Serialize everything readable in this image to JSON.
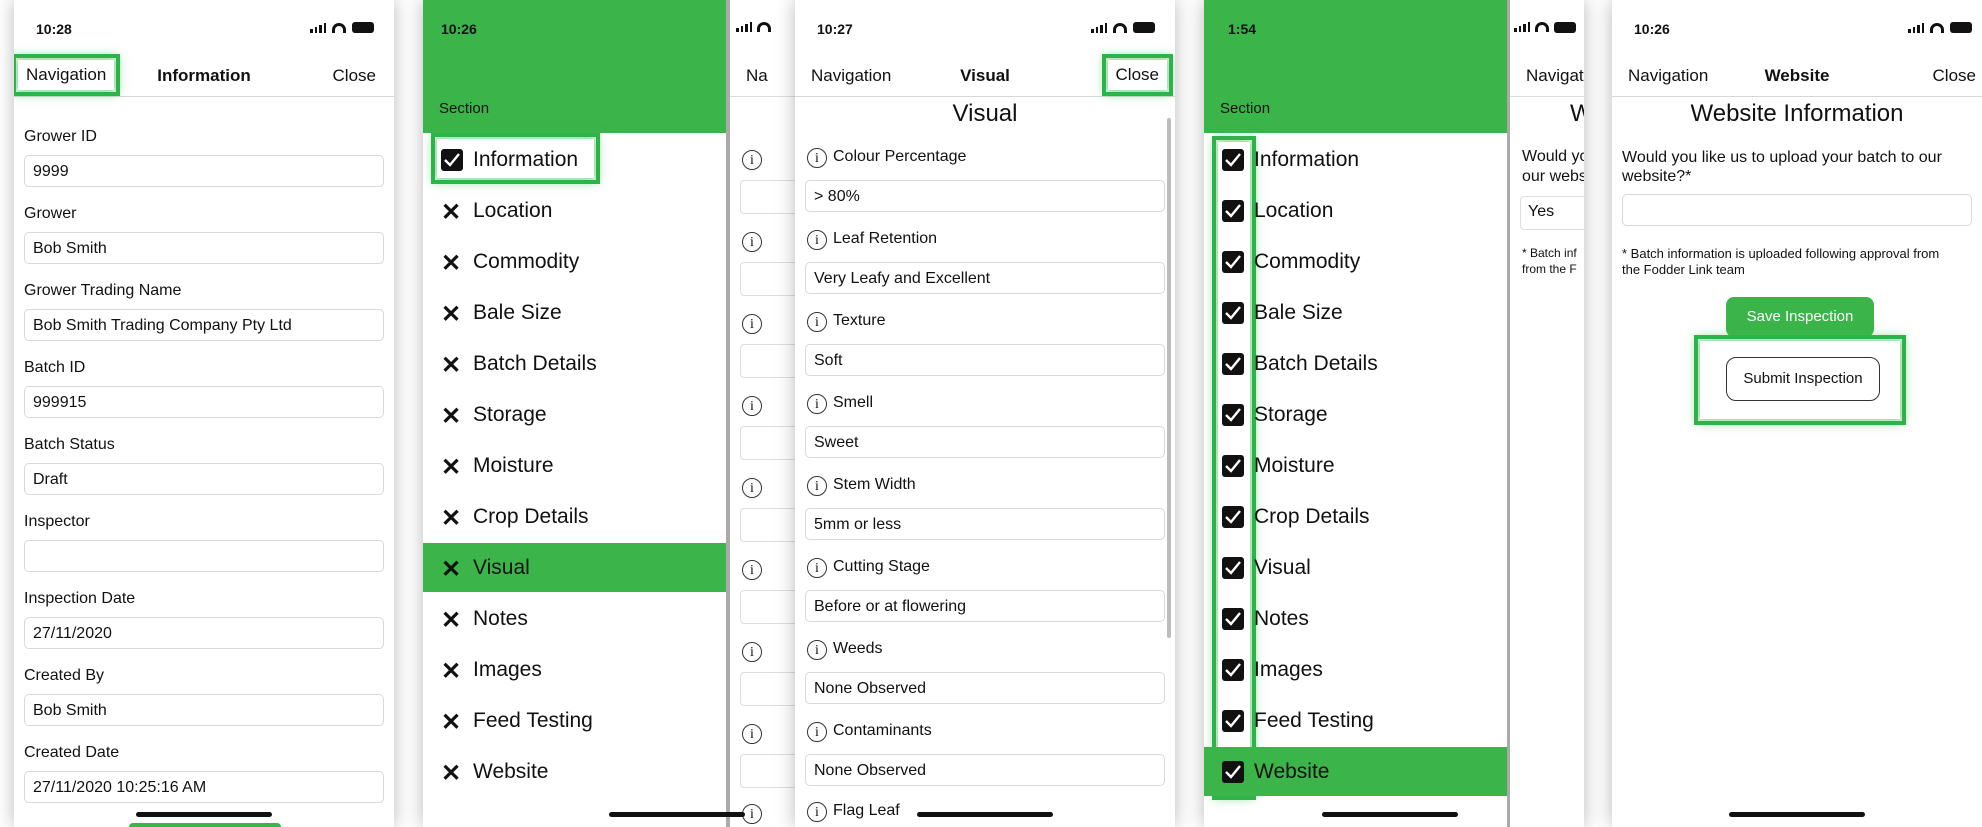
{
  "colors": {
    "accent": "#3bb44a",
    "highlight": "#2db34a"
  },
  "screen1": {
    "time": "10:28",
    "nav": {
      "left": "Navigation",
      "title": "Information",
      "right": "Close"
    },
    "fields": [
      {
        "label": "Grower ID",
        "value": "9999"
      },
      {
        "label": "Grower",
        "value": "Bob Smith"
      },
      {
        "label": "Grower Trading Name",
        "value": "Bob Smith Trading Company Pty Ltd"
      },
      {
        "label": "Batch ID",
        "value": "999915"
      },
      {
        "label": "Batch Status",
        "value": "Draft"
      },
      {
        "label": "Inspector",
        "value": ""
      },
      {
        "label": "Inspection Date",
        "value": "27/11/2020"
      },
      {
        "label": "Created By",
        "value": "Bob Smith"
      },
      {
        "label": "Created Date",
        "value": "27/11/2020 10:25:16 AM"
      }
    ]
  },
  "screen2": {
    "time": "10:26",
    "section_label": "Section",
    "peek_nav": "Na",
    "items": [
      {
        "label": "Information",
        "state": "checked"
      },
      {
        "label": "Location",
        "state": "x"
      },
      {
        "label": "Commodity",
        "state": "x"
      },
      {
        "label": "Bale Size",
        "state": "x"
      },
      {
        "label": "Batch Details",
        "state": "x"
      },
      {
        "label": "Storage",
        "state": "x"
      },
      {
        "label": "Moisture",
        "state": "x"
      },
      {
        "label": "Crop Details",
        "state": "x"
      },
      {
        "label": "Visual",
        "state": "x",
        "selected": true
      },
      {
        "label": "Notes",
        "state": "x"
      },
      {
        "label": "Images",
        "state": "x"
      },
      {
        "label": "Feed Testing",
        "state": "x"
      },
      {
        "label": "Website",
        "state": "x"
      }
    ]
  },
  "screen3": {
    "time": "10:27",
    "nav": {
      "left": "Navigation",
      "title": "Visual",
      "right": "Close"
    },
    "heading": "Visual",
    "fields": [
      {
        "label": "Colour Percentage",
        "value": "> 80%"
      },
      {
        "label": "Leaf Retention",
        "value": "Very Leafy and Excellent"
      },
      {
        "label": "Texture",
        "value": "Soft"
      },
      {
        "label": "Smell",
        "value": "Sweet"
      },
      {
        "label": "Stem Width",
        "value": "5mm or less"
      },
      {
        "label": "Cutting Stage",
        "value": "Before or at flowering"
      },
      {
        "label": "Weeds",
        "value": "None Observed"
      },
      {
        "label": "Contaminants",
        "value": "None Observed"
      },
      {
        "label": "Flag Leaf",
        "value": ""
      }
    ]
  },
  "screen4": {
    "time": "1:54",
    "section_label": "Section",
    "peek": {
      "nav": "Navigat",
      "heading": "W",
      "question_line1": "Would yo",
      "question_line2": "our webs",
      "answer": "Yes",
      "note_line1": "* Batch inf",
      "note_line2": "from the F"
    },
    "items": [
      {
        "label": "Information"
      },
      {
        "label": "Location"
      },
      {
        "label": "Commodity"
      },
      {
        "label": "Bale Size"
      },
      {
        "label": "Batch Details"
      },
      {
        "label": "Storage"
      },
      {
        "label": "Moisture"
      },
      {
        "label": "Crop Details"
      },
      {
        "label": "Visual"
      },
      {
        "label": "Notes"
      },
      {
        "label": "Images"
      },
      {
        "label": "Feed Testing"
      },
      {
        "label": "Website",
        "selected": true
      }
    ]
  },
  "screen5": {
    "time": "10:26",
    "nav": {
      "left": "Navigation",
      "title": "Website",
      "right": "Close"
    },
    "heading": "Website Information",
    "question": "Would you like us to upload your batch to our website?*",
    "answer": "",
    "note": "* Batch information is uploaded following approval from the Fodder Link team",
    "save_label": "Save Inspection",
    "submit_label": "Submit Inspection"
  }
}
